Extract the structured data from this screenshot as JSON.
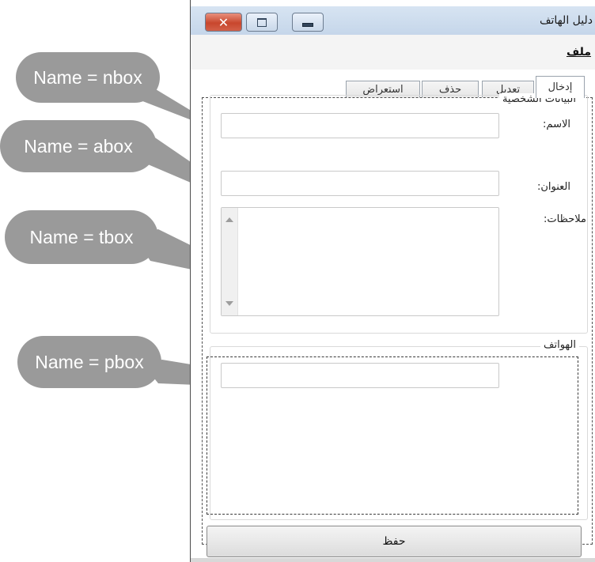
{
  "window": {
    "title": "دليل الهاتف",
    "close_glyph": "✕"
  },
  "menu": {
    "file_label": "ملف"
  },
  "tabs": [
    {
      "label": "إدخال",
      "active": true
    },
    {
      "label": "تعديل",
      "active": false
    },
    {
      "label": "حذف",
      "active": false
    },
    {
      "label": "استعراض",
      "active": false
    }
  ],
  "personal_group": {
    "title": "البيانات الشخصية",
    "name_label": "الاسم:",
    "address_label": "العنوان:",
    "notes_label": "ملاحظات:"
  },
  "phones_group": {
    "title": "الهواتف"
  },
  "save_button": {
    "label": "حفظ"
  },
  "callouts": [
    {
      "text": "Name = nbox"
    },
    {
      "text": "Name = abox"
    },
    {
      "text": "Name = tbox"
    },
    {
      "text": "Name = pbox"
    }
  ],
  "colors": {
    "callout": "#9a9a9a",
    "titlebar": "#c5d6ea",
    "close_button": "#c8472d"
  }
}
